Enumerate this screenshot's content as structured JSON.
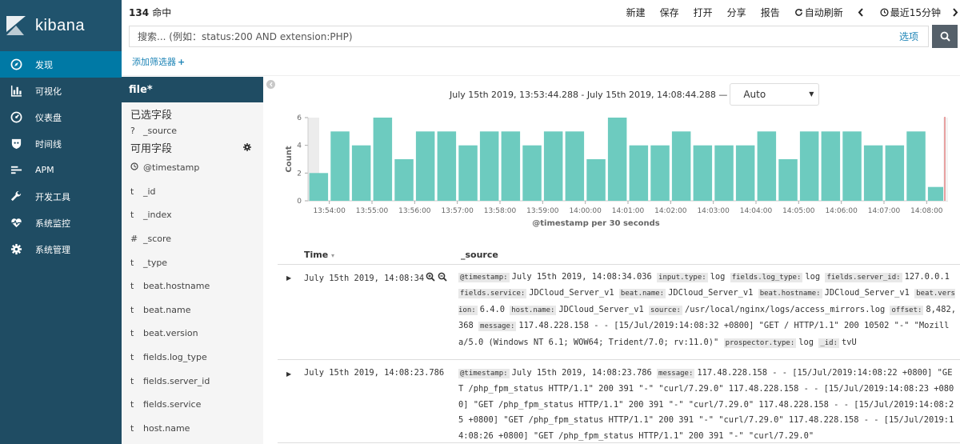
{
  "brand": {
    "name": "kibana"
  },
  "nav": [
    {
      "label": "发现",
      "icon": "compass-icon",
      "active": true
    },
    {
      "label": "可视化",
      "icon": "bar-chart-icon"
    },
    {
      "label": "仪表盘",
      "icon": "dashboard-icon"
    },
    {
      "label": "时间线",
      "icon": "shield-icon"
    },
    {
      "label": "APM",
      "icon": "list-icon"
    },
    {
      "label": "开发工具",
      "icon": "wrench-icon"
    },
    {
      "label": "系统监控",
      "icon": "heartbeat-icon"
    },
    {
      "label": "系统管理",
      "icon": "gear-icon"
    }
  ],
  "topbar": {
    "hits": "134",
    "hits_unit": "命中",
    "menu": [
      "新建",
      "保存",
      "打开",
      "分享",
      "报告"
    ],
    "auto_refresh": "自动刷新",
    "time_picker": "最近15分钟"
  },
  "search": {
    "placeholder": "搜索... (例如：status:200 AND extension:PHP)",
    "options": "选项"
  },
  "filter": {
    "add_label": "添加筛选器",
    "plus": "+"
  },
  "sidebar": {
    "index": "file*",
    "selected_title": "已选字段",
    "selected_fields": [
      {
        "type": "?",
        "name": "_source"
      }
    ],
    "available_title": "可用字段",
    "available_fields": [
      {
        "type": "clock",
        "name": "@timestamp"
      },
      {
        "type": "t",
        "name": "_id"
      },
      {
        "type": "t",
        "name": "_index"
      },
      {
        "type": "#",
        "name": "_score"
      },
      {
        "type": "t",
        "name": "_type"
      },
      {
        "type": "t",
        "name": "beat.hostname"
      },
      {
        "type": "t",
        "name": "beat.name"
      },
      {
        "type": "t",
        "name": "beat.version"
      },
      {
        "type": "t",
        "name": "fields.log_type"
      },
      {
        "type": "t",
        "name": "fields.server_id"
      },
      {
        "type": "t",
        "name": "fields.service"
      },
      {
        "type": "t",
        "name": "host.name"
      }
    ]
  },
  "chart": {
    "range": "July 15th 2019, 13:53:44.288 - July 15th 2019, 14:08:44.288 —",
    "interval": "Auto",
    "bar_color": "#6dcbbf"
  },
  "chart_data": {
    "type": "bar",
    "xlabel": "@timestamp per 30 seconds",
    "ylabel": "Count",
    "ylim": [
      0,
      6
    ],
    "yticks": [
      0,
      2,
      4,
      6
    ],
    "tick_labels": [
      "13:54:00",
      "13:55:00",
      "13:56:00",
      "13:57:00",
      "13:58:00",
      "13:59:00",
      "14:00:00",
      "14:01:00",
      "14:02:00",
      "14:03:00",
      "14:04:00",
      "14:05:00",
      "14:06:00",
      "14:07:00",
      "14:08:00"
    ],
    "values": [
      2,
      5,
      4,
      6,
      3,
      5,
      5,
      4,
      5,
      5,
      4,
      5,
      5,
      3,
      6,
      4,
      4,
      5,
      4,
      4,
      4,
      5,
      3,
      5,
      5,
      5,
      4,
      4,
      5,
      1
    ]
  },
  "table": {
    "col_time": "Time",
    "col_source": "_source",
    "rows": [
      {
        "time": "July 15th 2019, 14:08:34",
        "source": [
          [
            "@timestamp:",
            "July 15th 2019, 14:08:34.036"
          ],
          [
            "input.type:",
            "log"
          ],
          [
            "fields.log_type:",
            "log"
          ],
          [
            "fields.server_id:",
            "127.0.0.1"
          ],
          [
            "fields.service:",
            "JDCloud_Server_v1"
          ],
          [
            "beat.name:",
            "JDCloud_Server_v1"
          ],
          [
            "beat.hostname:",
            "JDCloud_Server_v1"
          ],
          [
            "beat.version:",
            "6.4.0"
          ],
          [
            "host.name:",
            "JDCloud_Server_v1"
          ],
          [
            "source:",
            "/usr/local/nginx/logs/access_mirrors.log"
          ],
          [
            "offset:",
            "8,482,368"
          ],
          [
            "message:",
            "117.48.228.158 - - [15/Jul/2019:14:08:32 +0800] \"GET / HTTP/1.1\" 200 10502 \"-\" \"Mozilla/5.0 (Windows NT 6.1; WOW64; Trident/7.0; rv:11.0)\""
          ],
          [
            "prospector.type:",
            "log"
          ],
          [
            "_id:",
            "tvU"
          ]
        ]
      },
      {
        "time": "July 15th 2019, 14:08:23.786",
        "source": [
          [
            "@timestamp:",
            "July 15th 2019, 14:08:23.786"
          ],
          [
            "message:",
            "117.48.228.158 - - [15/Jul/2019:14:08:22 +0800] \"GET /php_fpm_status HTTP/1.1\" 200 391 \"-\" \"curl/7.29.0\" 117.48.228.158 - - [15/Jul/2019:14:08:23 +0800] \"GET /php_fpm_status HTTP/1.1\" 200 391 \"-\" \"curl/7.29.0\" 117.48.228.158 - - [15/Jul/2019:14:08:25 +0800] \"GET /php_fpm_status HTTP/1.1\" 200 391 \"-\" \"curl/7.29.0\" 117.48.228.158 - - [15/Jul/2019:14:08:26 +0800] \"GET /php_fpm_status HTTP/1.1\" 200 391 \"-\" \"curl/7.29.0\""
          ]
        ]
      }
    ]
  }
}
